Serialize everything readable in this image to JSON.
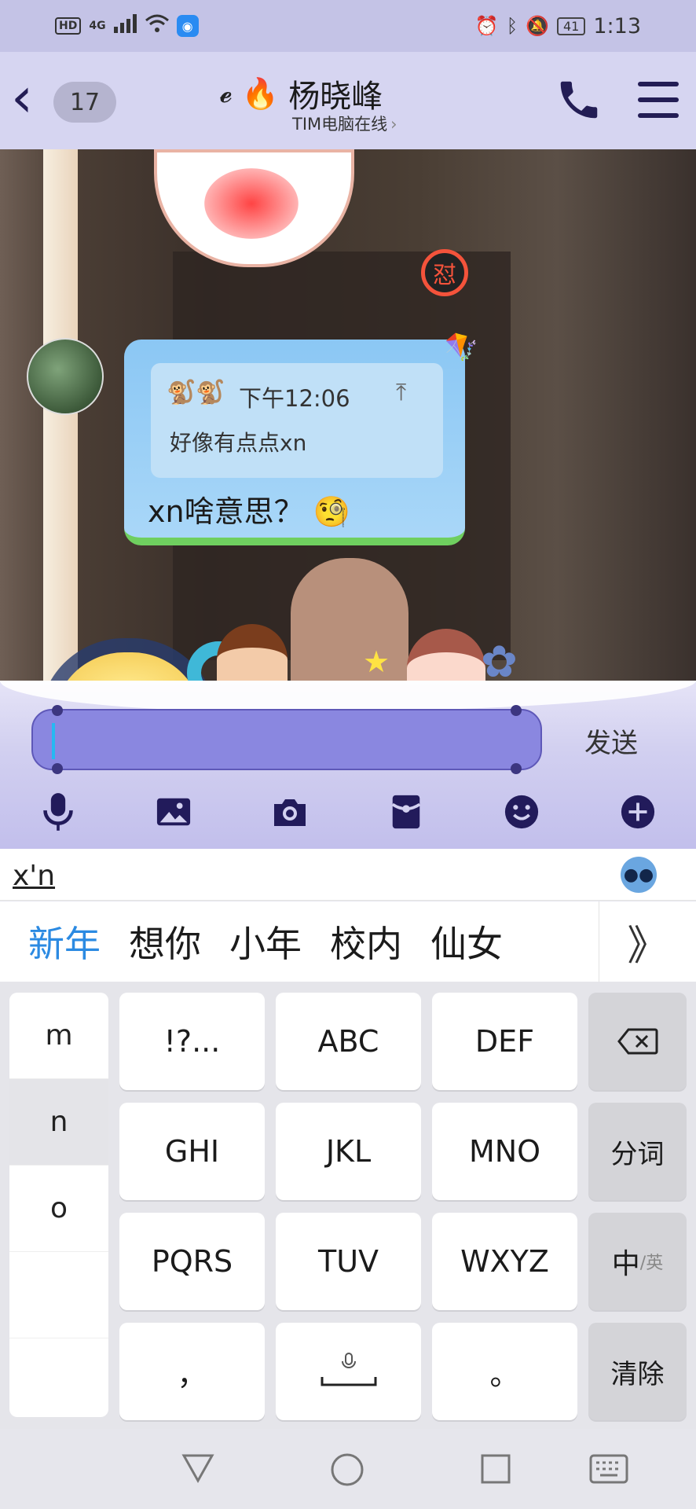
{
  "status_bar": {
    "hd": "HD",
    "network": "4G",
    "battery": "41",
    "time": "1:13"
  },
  "header": {
    "unread_count": "17",
    "title": "杨晓峰",
    "subtitle": "TIM电脑在线"
  },
  "chat": {
    "quote": {
      "time": "下午12:06",
      "text": "好像有点点xn"
    },
    "message": "xn啥意思？"
  },
  "input": {
    "value": "",
    "send_label": "发送"
  },
  "toolbar": {
    "icons": [
      "microphone-icon",
      "image-icon",
      "camera-icon",
      "red-packet-icon",
      "emoji-icon",
      "plus-icon"
    ]
  },
  "ime": {
    "composing": "x'n",
    "candidates": [
      "新年",
      "想你",
      "小年",
      "校内",
      "仙女"
    ],
    "more": "》",
    "side_letters": [
      "m",
      "n",
      "o",
      "",
      ""
    ],
    "keys": {
      "row1": [
        "!?...",
        "ABC",
        "DEF"
      ],
      "row2": [
        "GHI",
        "JKL",
        "MNO"
      ],
      "row3": [
        "PQRS",
        "TUV",
        "WXYZ"
      ],
      "row4": [
        "，",
        "",
        "。"
      ],
      "fn": {
        "backspace": "⌫",
        "segment": "分词",
        "lang_main": "中",
        "lang_sub": "/英",
        "clear": "清除"
      }
    }
  },
  "colors": {
    "header_bg": "#d6d5f1",
    "candidate_highlight": "#2b8ae2",
    "input_bg": "#8a87e0"
  }
}
